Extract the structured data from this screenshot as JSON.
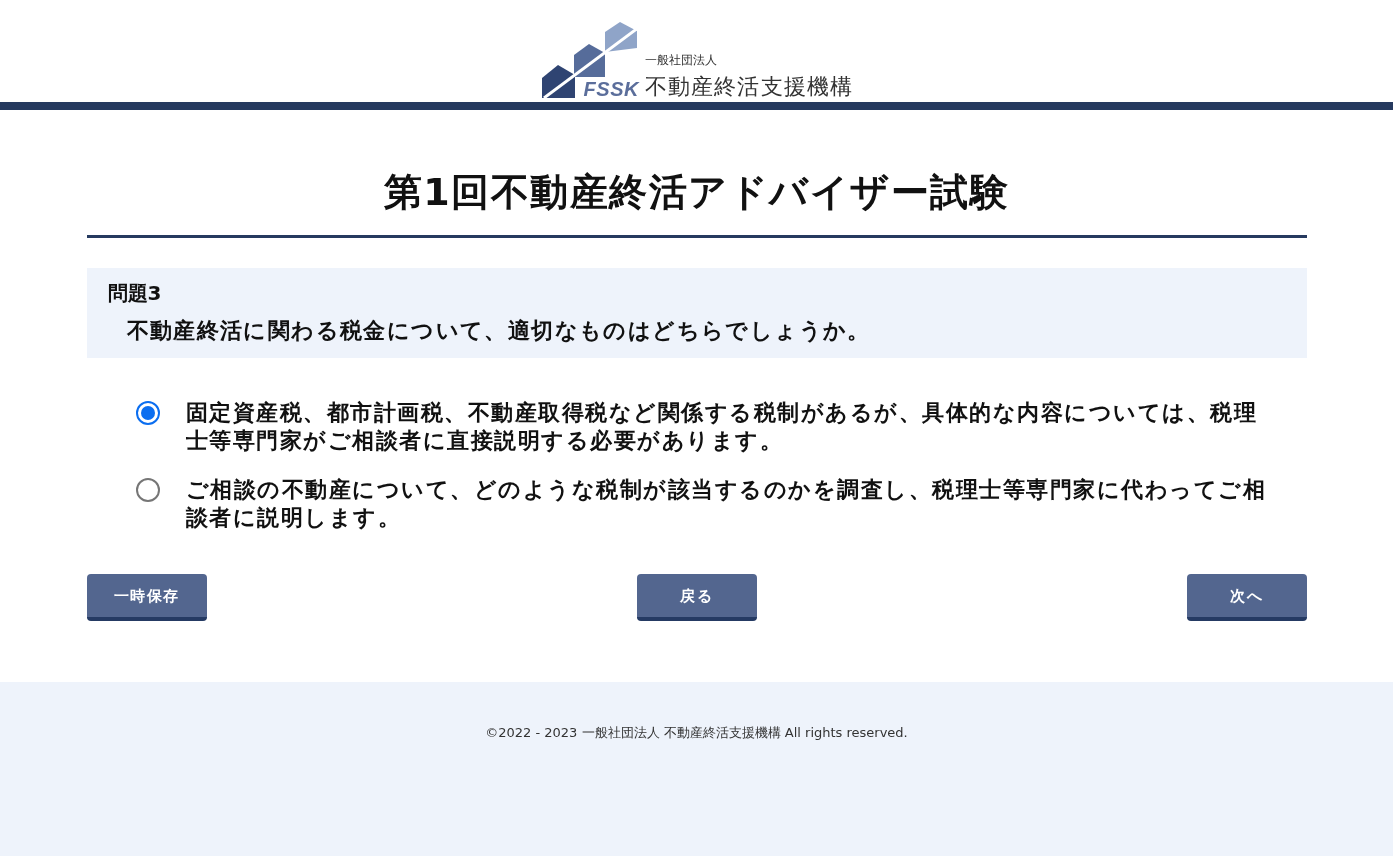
{
  "header": {
    "logo": {
      "mark_text": "FSSK",
      "org_type": "一般社団法人",
      "org_name": "不動産終活支援機構"
    }
  },
  "title": "第1回不動産終活アドバイザー試験",
  "question": {
    "label": "問題3",
    "text": "不動産終活に関わる税金について、適切なものはどちらでしょうか。"
  },
  "options": [
    {
      "text": "固定資産税、都市計画税、不動産取得税など関係する税制があるが、具体的な内容については、税理士等専門家がご相談者に直接説明する必要があります。",
      "selected": true
    },
    {
      "text": "ご相談の不動産について、どのような税制が該当するのかを調査し、税理士等専門家に代わってご相談者に説明します。",
      "selected": false
    }
  ],
  "buttons": [
    "一時保存",
    "戻る",
    "次へ"
  ],
  "footer": {
    "copyright": "©2022 - 2023 一般社団法人 不動産終活支援機構 All rights reserved."
  }
}
